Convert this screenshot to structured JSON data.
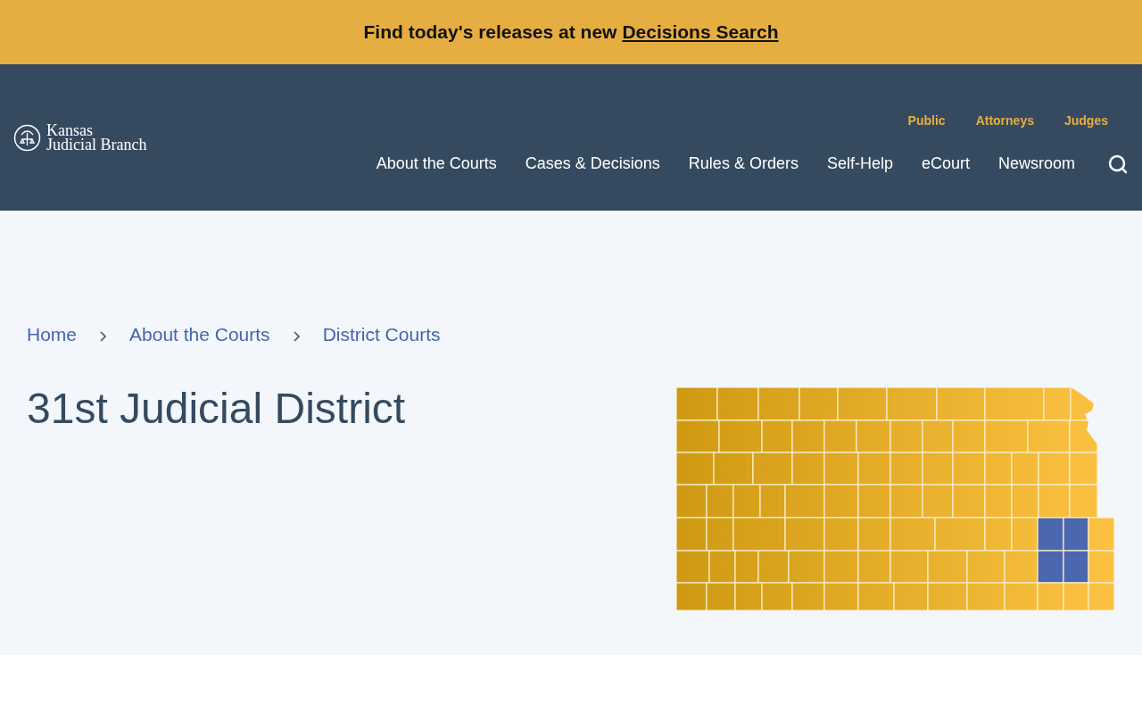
{
  "banner": {
    "text": "Find today's releases at new",
    "link": "Decisions Search"
  },
  "header": {
    "logo": {
      "line1": "Kansas",
      "line2": "Judicial Branch"
    },
    "audience_links": [
      "Public",
      "Attorneys",
      "Judges"
    ],
    "nav": [
      "About the Courts",
      "Cases & Decisions",
      "Rules & Orders",
      "Self-Help",
      "eCourt",
      "Newsroom"
    ]
  },
  "breadcrumb": [
    "Home",
    "About the Courts",
    "District Courts"
  ],
  "page": {
    "title": "31st Judicial District"
  }
}
